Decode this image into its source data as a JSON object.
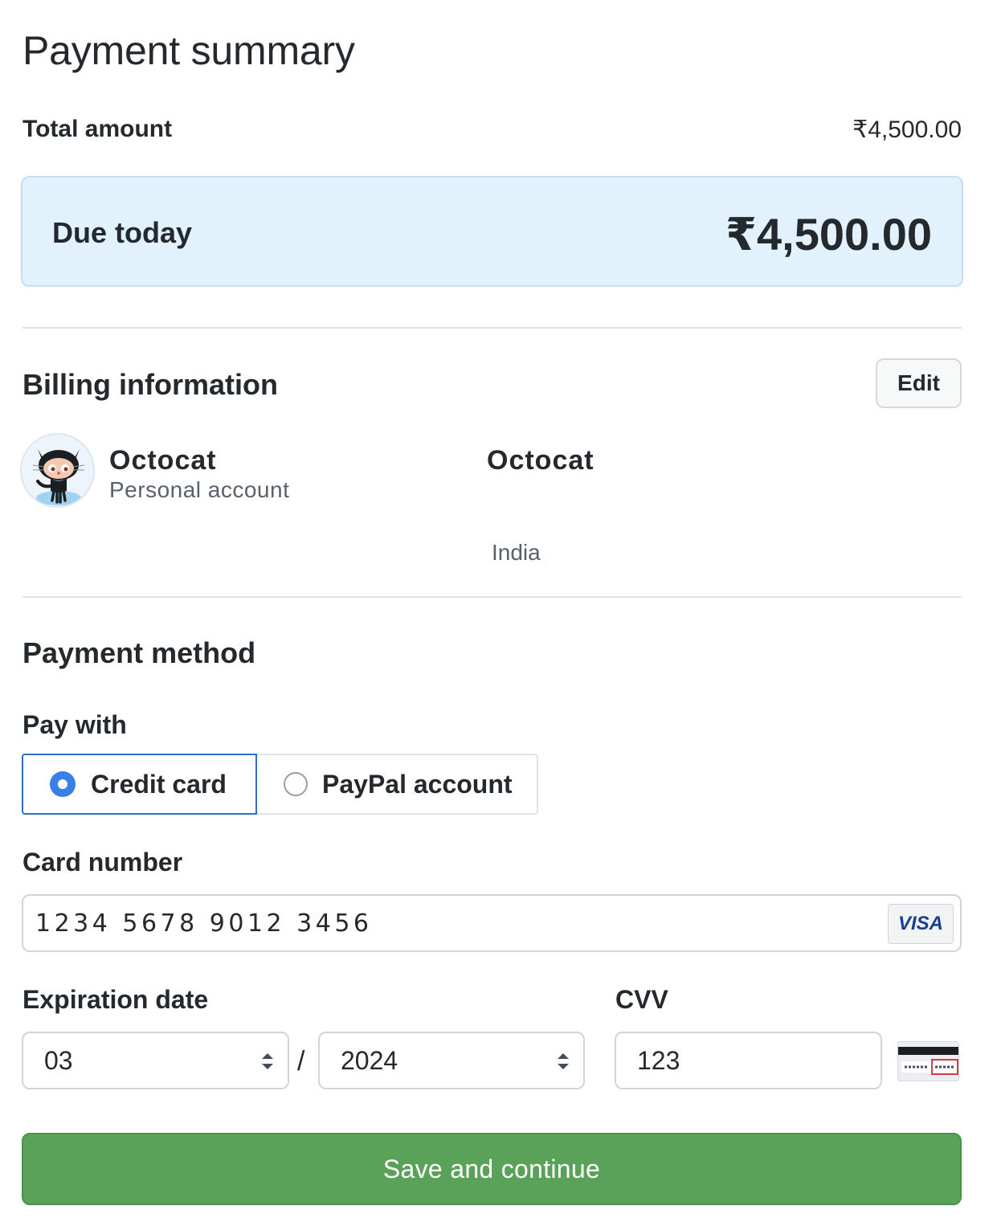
{
  "summary": {
    "title": "Payment summary",
    "total_label": "Total amount",
    "total_value": "₹4,500.00",
    "due_label": "Due today",
    "due_value": "₹4,500.00"
  },
  "billing": {
    "title": "Billing information",
    "edit_label": "Edit",
    "account_name": "Octocat",
    "account_type": "Personal account",
    "billing_name": "Octocat",
    "country": "India"
  },
  "payment": {
    "title": "Payment method",
    "pay_with_label": "Pay with",
    "options": [
      {
        "label": "Credit card",
        "selected": true
      },
      {
        "label": "PayPal account",
        "selected": false
      }
    ],
    "card_number_label": "Card number",
    "card_number_value": "1234 5678 9012 3456",
    "card_brand": "VISA",
    "expiration_label": "Expiration date",
    "exp_month": "03",
    "exp_separator": "/",
    "exp_year": "2024",
    "cvv_label": "CVV",
    "cvv_value": "123",
    "save_label": "Save and continue"
  },
  "colors": {
    "accent_blue": "#3a7ee8",
    "due_background": "#e2f2fd",
    "primary_button": "#5aa259"
  },
  "icons": {
    "avatar": "octocat-avatar",
    "card_brand": "visa-icon",
    "cvv": "cvv-card-icon",
    "select_arrows": "chevron-up-down-icon"
  }
}
